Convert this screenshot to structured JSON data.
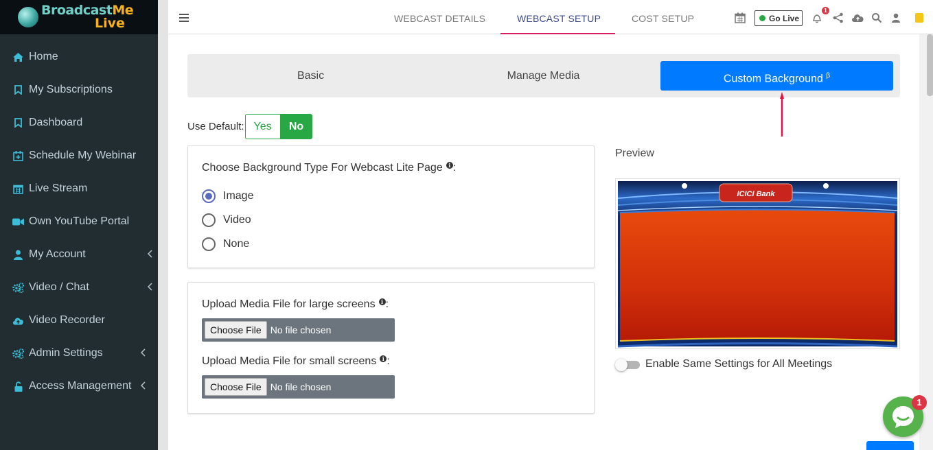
{
  "logo": {
    "line1_a": "Broadcast",
    "line1_b": "Me",
    "line2": "Live"
  },
  "sidebar": {
    "items": [
      {
        "label": "Home",
        "icon": "home-icon"
      },
      {
        "label": "My Subscriptions",
        "icon": "bookmark-icon"
      },
      {
        "label": "Dashboard",
        "icon": "bookmark-icon"
      },
      {
        "label": "Schedule My Webinar",
        "icon": "calendar-plus-icon"
      },
      {
        "label": "Live Stream",
        "icon": "calendar-icon"
      },
      {
        "label": "Own YouTube Portal",
        "icon": "video-camera-icon"
      },
      {
        "label": "My Account",
        "icon": "user-icon"
      },
      {
        "label": "Video / Chat",
        "icon": "gears-icon"
      },
      {
        "label": "Video Recorder",
        "icon": "cloud-upload-icon"
      },
      {
        "label": "Admin Settings",
        "icon": "gears-icon"
      },
      {
        "label": "Access Management",
        "icon": "unlock-icon"
      }
    ]
  },
  "header": {
    "tabs": [
      {
        "label": "WEBCAST DETAILS"
      },
      {
        "label": "WEBCAST SETUP"
      },
      {
        "label": "COST SETUP"
      }
    ],
    "go_live": "Go Live",
    "notification_count": "1"
  },
  "subtabs": [
    {
      "label": "Basic"
    },
    {
      "label": "Manage Media"
    },
    {
      "label": "Custom Background",
      "sup": "β"
    }
  ],
  "use_default": {
    "label": "Use Default:",
    "yes": "Yes",
    "no": "No"
  },
  "background_type": {
    "label": "Choose Background Type For Webcast Lite Page",
    "options": [
      "Image",
      "Video",
      "None"
    ]
  },
  "upload": {
    "large_label": "Upload Media File for large screens",
    "small_label": "Upload Media File for small screens",
    "choose_file": "Choose File",
    "no_file": "No file chosen"
  },
  "preview": {
    "label": "Preview",
    "logo_text": "ICICI Bank"
  },
  "enable_same": "Enable Same Settings for All Meetings",
  "chat_badge": "1",
  "colors": {
    "primary": "#007bff",
    "success": "#28a745",
    "sidebar": "#222d32",
    "accent": "#d81b60"
  }
}
